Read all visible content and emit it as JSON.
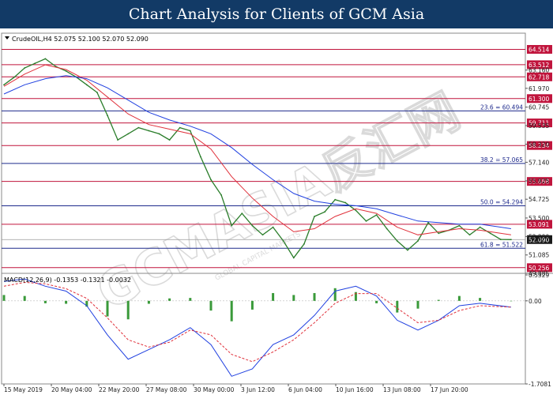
{
  "header": {
    "title": "Chart Analysis for Clients of GCM Asia"
  },
  "watermark": {
    "main": "GCMASIA反汇网",
    "sub": "GLOBAL CAPITAL MARKETS"
  },
  "colors": {
    "header_bg": "#123a66",
    "resistance": "#c0143c",
    "fibo": "#1e2a8c",
    "price": "#2a7d2a",
    "ma_fast": "#e0303a",
    "ma_slow": "#2040e0",
    "macd_line": "#2040e0",
    "signal_line": "#e0303a",
    "histogram": "#3a9a3a",
    "current_price_bg": "#1a1a1a"
  },
  "chart_data": {
    "type": "line",
    "symbol_info": "CrudeOIL,H4  52.075 52.100 52.070 52.090",
    "price_ylim": [
      49.885,
      65.52
    ],
    "x_tick_labels": [
      "15 May 2019",
      "20 May 04:00",
      "22 May 20:00",
      "27 May 08:00",
      "30 May 00:00",
      "3 Jun 12:00",
      "6 Jun 04:00",
      "10 Jun 16:00",
      "13 Jun 08:00",
      "17 Jun 20:00"
    ],
    "y_tick_labels": [
      "63.160",
      "61.970",
      "60.745",
      "59.535",
      "58.320",
      "57.140",
      "55.925",
      "54.725",
      "53.500",
      "52.290",
      "51.085",
      "49.885"
    ],
    "current_price": "52.090",
    "resistance_levels": [
      {
        "label": "64.514",
        "value": 64.514
      },
      {
        "label": "63.512",
        "value": 63.512
      },
      {
        "label": "62.718",
        "value": 62.718
      },
      {
        "label": "61.300",
        "value": 61.3
      },
      {
        "label": "59.711",
        "value": 59.711
      },
      {
        "label": "58.234",
        "value": 58.234
      },
      {
        "label": "55.888",
        "value": 55.888
      },
      {
        "label": "53.091",
        "value": 53.091
      },
      {
        "label": "50.256",
        "value": 50.256
      }
    ],
    "fibonacci_levels": [
      {
        "label": "23.6 = 60.494",
        "value": 60.494
      },
      {
        "label": "38.2 = 57.065",
        "value": 57.065
      },
      {
        "label": "50.0 = 54.294",
        "value": 54.294
      },
      {
        "label": "61.8 = 51.522",
        "value": 51.522
      }
    ],
    "price_series": [
      {
        "name": "close",
        "x": [
          0,
          3,
          6,
          9,
          12,
          15,
          18,
          21,
          24,
          27,
          30,
          33,
          36,
          39,
          42,
          45,
          48,
          51,
          54,
          57,
          60,
          63,
          66,
          69,
          72,
          75,
          78,
          81,
          84,
          87,
          90,
          93,
          96,
          99,
          102,
          105,
          108,
          111,
          114,
          117,
          120,
          123,
          126,
          129,
          132,
          135,
          138,
          141,
          144,
          147
        ],
        "values": [
          62.2,
          62.7,
          63.3,
          63.6,
          63.9,
          63.4,
          63.1,
          62.7,
          62.2,
          61.7,
          60.2,
          58.6,
          59.0,
          59.4,
          59.2,
          59.0,
          58.6,
          59.4,
          59.2,
          57.5,
          56.0,
          55.0,
          53.0,
          53.8,
          53.0,
          52.4,
          52.9,
          52.0,
          50.9,
          51.8,
          53.6,
          53.9,
          54.7,
          54.5,
          54.0,
          53.3,
          53.7,
          52.8,
          52.0,
          51.4,
          52.0,
          53.2,
          52.5,
          52.7,
          53.0,
          52.4,
          52.9,
          52.5,
          52.1,
          52.09
        ]
      },
      {
        "name": "MA fast",
        "x": [
          0,
          6,
          12,
          18,
          24,
          30,
          36,
          42,
          48,
          54,
          60,
          66,
          72,
          78,
          84,
          90,
          96,
          102,
          108,
          114,
          120,
          126,
          132,
          138,
          147
        ],
        "values": [
          62.1,
          62.9,
          63.5,
          63.2,
          62.5,
          61.4,
          60.3,
          59.6,
          59.3,
          59.0,
          58.0,
          56.2,
          54.8,
          53.6,
          52.6,
          52.8,
          53.6,
          54.1,
          53.8,
          52.9,
          52.4,
          52.6,
          52.8,
          52.7,
          52.4
        ]
      },
      {
        "name": "MA slow",
        "x": [
          0,
          6,
          12,
          18,
          24,
          30,
          36,
          42,
          48,
          54,
          60,
          66,
          72,
          78,
          84,
          90,
          96,
          102,
          108,
          114,
          120,
          126,
          132,
          138,
          147
        ],
        "values": [
          61.6,
          62.2,
          62.6,
          62.8,
          62.6,
          62.0,
          61.2,
          60.4,
          59.9,
          59.5,
          59.0,
          58.1,
          57.0,
          56.0,
          55.1,
          54.6,
          54.4,
          54.3,
          54.1,
          53.7,
          53.3,
          53.2,
          53.1,
          53.1,
          52.8
        ]
      }
    ],
    "macd": {
      "label": "MACD(12,26,9) -0.1353 -0.1321 -0.0032",
      "ylim": [
        -1.7081,
        0.5329
      ],
      "y_tick_labels": [
        "0.5329",
        "0.00",
        "-1.7081"
      ],
      "x": [
        0,
        6,
        12,
        18,
        24,
        30,
        36,
        42,
        48,
        54,
        60,
        66,
        72,
        78,
        84,
        90,
        96,
        102,
        108,
        114,
        120,
        126,
        132,
        138,
        147
      ],
      "macd_values": [
        0.4,
        0.45,
        0.3,
        0.2,
        -0.1,
        -0.7,
        -1.2,
        -1.0,
        -0.8,
        -0.55,
        -0.9,
        -1.55,
        -1.4,
        -0.9,
        -0.7,
        -0.3,
        0.2,
        0.3,
        0.1,
        -0.4,
        -0.6,
        -0.4,
        -0.1,
        -0.05,
        -0.13
      ],
      "signal_values": [
        0.3,
        0.38,
        0.35,
        0.25,
        0.05,
        -0.35,
        -0.8,
        -0.95,
        -0.85,
        -0.6,
        -0.7,
        -1.1,
        -1.25,
        -1.05,
        -0.8,
        -0.45,
        -0.05,
        0.15,
        0.15,
        -0.15,
        -0.45,
        -0.4,
        -0.2,
        -0.1,
        -0.13
      ],
      "histogram": [
        0.12,
        0.1,
        -0.05,
        -0.06,
        -0.12,
        -0.32,
        -0.38,
        -0.06,
        0.05,
        0.06,
        -0.2,
        -0.42,
        -0.18,
        0.16,
        0.12,
        0.16,
        0.26,
        0.18,
        -0.05,
        -0.24,
        -0.16,
        0.02,
        0.1,
        0.06,
        0.0
      ]
    }
  }
}
